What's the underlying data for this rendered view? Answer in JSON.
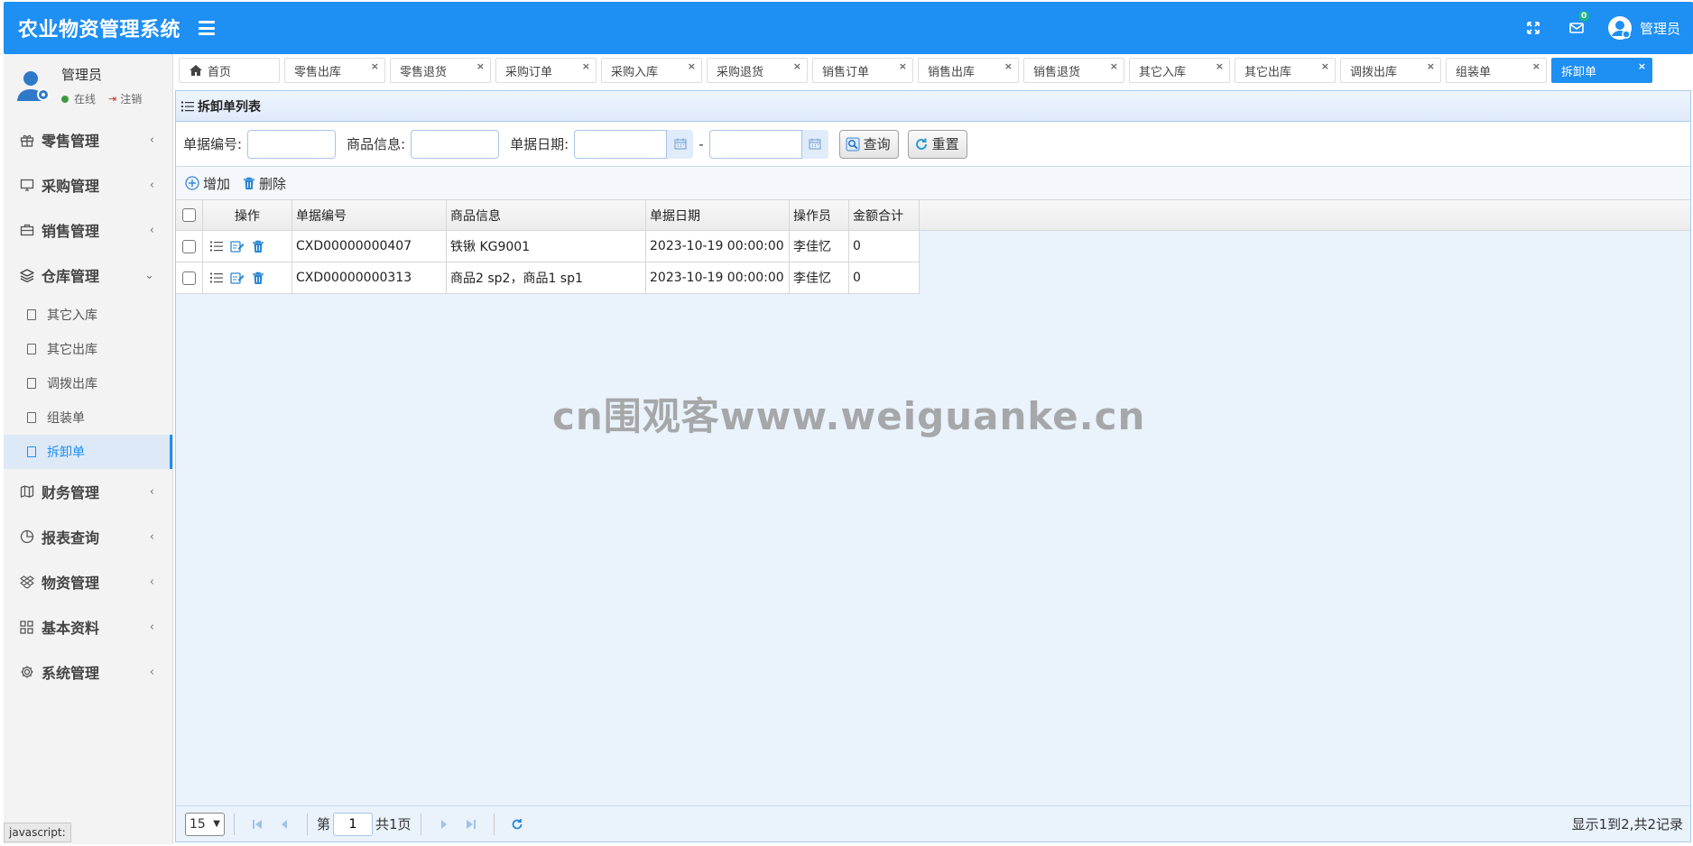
{
  "app": {
    "title": "农业物资管理系统"
  },
  "header": {
    "mail_badge": "0",
    "user_name": "管理员"
  },
  "profile": {
    "name": "管理员",
    "status": "在线",
    "logout": "注销"
  },
  "sidebar": {
    "items": [
      {
        "label": "零售管理",
        "icon": "gift-icon",
        "expanded": false
      },
      {
        "label": "采购管理",
        "icon": "monitor-icon",
        "expanded": false
      },
      {
        "label": "销售管理",
        "icon": "briefcase-icon",
        "expanded": false
      },
      {
        "label": "仓库管理",
        "icon": "layers-icon",
        "expanded": true
      },
      {
        "label": "财务管理",
        "icon": "map-icon",
        "expanded": false
      },
      {
        "label": "报表查询",
        "icon": "pie-chart-icon",
        "expanded": false
      },
      {
        "label": "物资管理",
        "icon": "dropbox-icon",
        "expanded": false
      },
      {
        "label": "基本资料",
        "icon": "grid-icon",
        "expanded": false
      },
      {
        "label": "系统管理",
        "icon": "gear-icon",
        "expanded": false
      }
    ],
    "sub_items": [
      {
        "label": "其它入库"
      },
      {
        "label": "其它出库"
      },
      {
        "label": "调拨出库"
      },
      {
        "label": "组装单"
      },
      {
        "label": "拆卸单"
      }
    ]
  },
  "tabs": [
    {
      "label": "首页",
      "closable": false
    },
    {
      "label": "零售出库",
      "closable": true
    },
    {
      "label": "零售退货",
      "closable": true
    },
    {
      "label": "采购订单",
      "closable": true
    },
    {
      "label": "采购入库",
      "closable": true
    },
    {
      "label": "采购退货",
      "closable": true
    },
    {
      "label": "销售订单",
      "closable": true
    },
    {
      "label": "销售出库",
      "closable": true
    },
    {
      "label": "销售退货",
      "closable": true
    },
    {
      "label": "其它入库",
      "closable": true
    },
    {
      "label": "其它出库",
      "closable": true
    },
    {
      "label": "调拨出库",
      "closable": true
    },
    {
      "label": "组装单",
      "closable": true
    },
    {
      "label": "拆卸单",
      "closable": true,
      "active": true
    }
  ],
  "panel": {
    "title": "拆卸单列表"
  },
  "search": {
    "bill_no_label": "单据编号:",
    "goods_label": "商品信息:",
    "date_label": "单据日期:",
    "date_sep": "-",
    "query_btn": "查询",
    "reset_btn": "重置"
  },
  "toolbar": {
    "add": "增加",
    "delete": "删除"
  },
  "table": {
    "columns": [
      "操作",
      "单据编号",
      "商品信息",
      "单据日期",
      "操作员",
      "金额合计"
    ],
    "rows": [
      {
        "bill_no": "CXD00000000407",
        "goods": "铁锹 KG9001",
        "date": "2023-10-19 00:00:00",
        "operator": "李佳忆",
        "amount": "0"
      },
      {
        "bill_no": "CXD00000000313",
        "goods": "商品2 sp2，商品1 sp1",
        "date": "2023-10-19 00:00:00",
        "operator": "李佳忆",
        "amount": "0"
      }
    ]
  },
  "pager": {
    "page_size": "15",
    "page_prefix": "第",
    "page_value": "1",
    "page_total": "共1页",
    "info": "显示1到2,共2记录"
  },
  "watermark": "cn围观客www.weiguanke.cn",
  "statusbar": "javascript:",
  "colors": {
    "primary": "#1e8ff3",
    "panel_bg": "#eaf2fc",
    "badge": "#1ab394"
  }
}
